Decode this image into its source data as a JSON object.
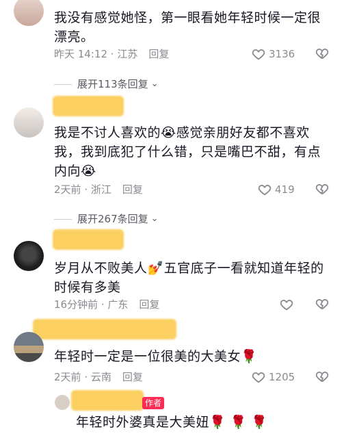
{
  "comments": [
    {
      "text": "我没有感觉她怪，第一眼看她年轻时候一定很漂亮。",
      "time": "昨天 14:12",
      "location": "江苏",
      "reply_label": "回复",
      "likes": "3136",
      "expand_label": "展开113条回复"
    },
    {
      "text": "我是不讨人喜欢的😭感觉亲朋好友都不喜欢我，我到底犯了什么错，只是嘴巴不甜，有点内向😭",
      "time": "2天前",
      "location": "浙江",
      "reply_label": "回复",
      "likes": "419",
      "expand_label": "展开267条回复"
    },
    {
      "text": "岁月从不败美人💅五官底子一看就知道年轻的时候有多美",
      "time": "16分钟前",
      "location": "广东",
      "reply_label": "回复",
      "likes": ""
    },
    {
      "text": "年轻时一定是一位很美的大美女🌹",
      "time": "2天前",
      "location": "云南",
      "reply_label": "回复",
      "likes": "1205"
    },
    {
      "tag": "作者",
      "text": "年轻时外婆真是大美妞🌹 🌹 🌹"
    }
  ],
  "colors": {
    "redaction": "#fbcf60",
    "meta": "#8a8b91",
    "author_tag": "#fe2c55"
  },
  "icons": {
    "like": "heart-outline-icon",
    "dislike": "broken-heart-icon",
    "expand": "chevron-down-icon"
  }
}
